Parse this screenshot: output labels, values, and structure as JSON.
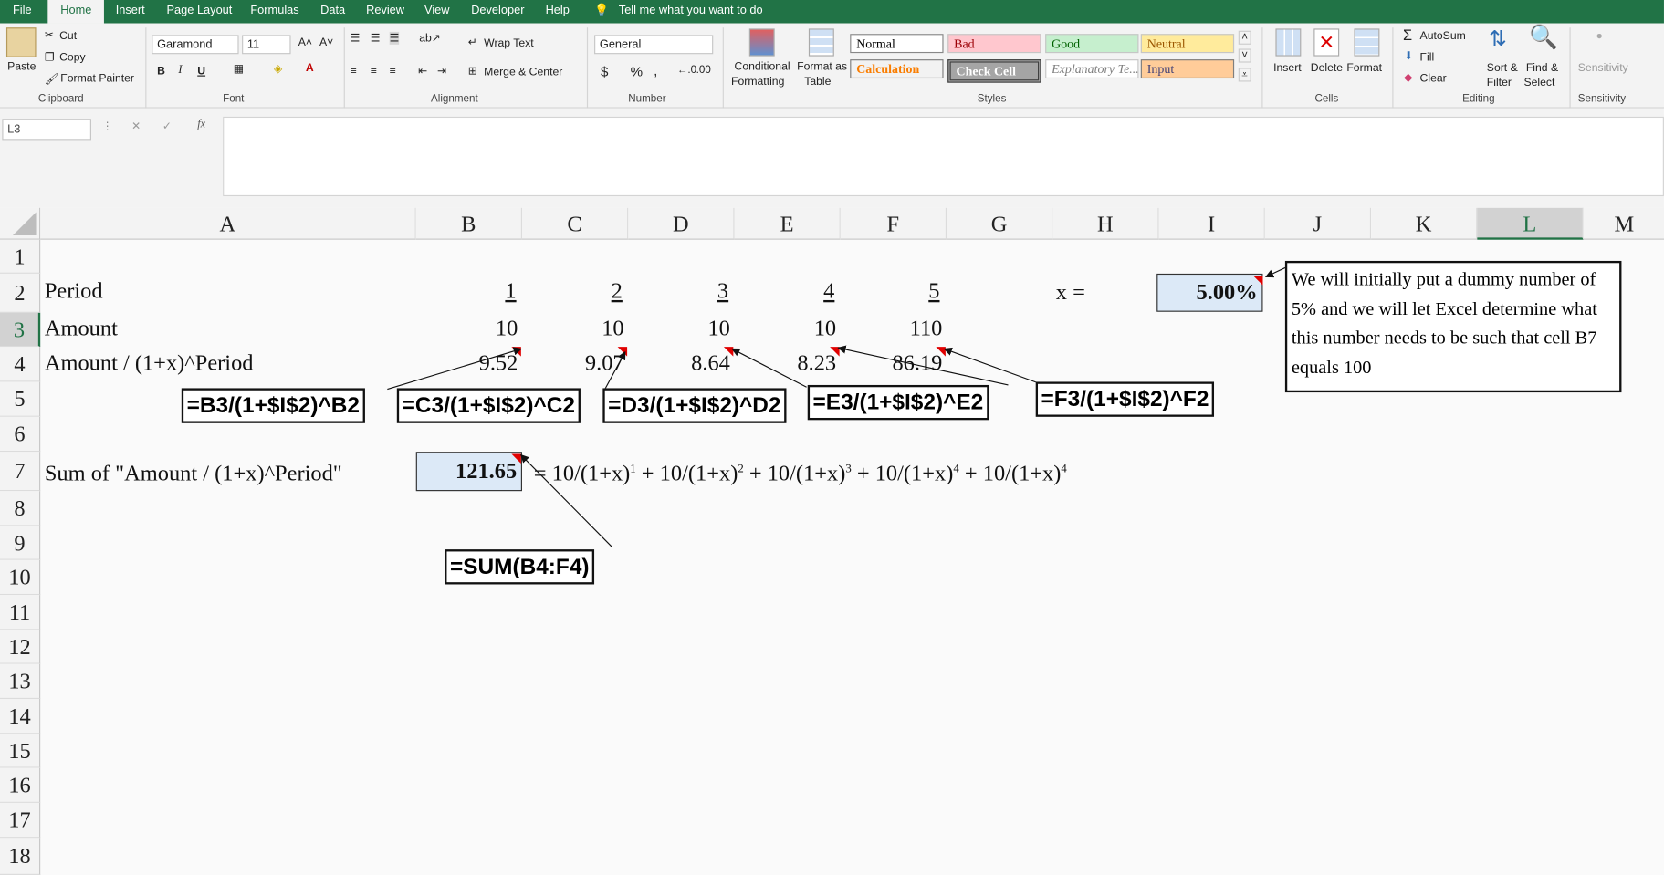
{
  "tabs": [
    "File",
    "Home",
    "Insert",
    "Page Layout",
    "Formulas",
    "Data",
    "Review",
    "View",
    "Developer",
    "Help",
    "Tell me what you want to do"
  ],
  "ribbon": {
    "clipboard": {
      "paste": "Paste",
      "cut": "Cut",
      "copy": "Copy",
      "format_painter": "Format Painter",
      "label": "Clipboard"
    },
    "font": {
      "name": "Garamond",
      "size": "11",
      "label": "Font",
      "bold": "B",
      "italic": "I",
      "underline": "U"
    },
    "alignment": {
      "wrap": "Wrap Text",
      "merge": "Merge & Center",
      "label": "Alignment"
    },
    "number": {
      "format": "General",
      "currency": "$",
      "percent": "%",
      "comma": ",",
      "label": "Number"
    },
    "styles": {
      "conditional": "Conditional",
      "conditional2": "Formatting",
      "format_table": "Format as",
      "format_table2": "Table",
      "normal": "Normal",
      "bad": "Bad",
      "good": "Good",
      "neutral": "Neutral",
      "calculation": "Calculation",
      "check": "Check Cell",
      "explanatory": "Explanatory Te...",
      "input": "Input",
      "label": "Styles"
    },
    "cells": {
      "insert": "Insert",
      "delete": "Delete",
      "format": "Format",
      "label": "Cells"
    },
    "editing": {
      "autosum": "AutoSum",
      "fill": "Fill",
      "clear": "Clear",
      "sort": "Sort &",
      "sort2": "Filter",
      "find": "Find &",
      "find2": "Select",
      "label": "Editing"
    },
    "sensitivity": {
      "btn": "Sensitivity",
      "label": "Sensitivity"
    }
  },
  "formula_bar": {
    "name_box": "L3",
    "cancel": "✕",
    "enter": "✓",
    "fx": "fx",
    "value": ""
  },
  "columns": [
    "A",
    "B",
    "C",
    "D",
    "E",
    "F",
    "G",
    "H",
    "I",
    "J",
    "K",
    "L",
    "M"
  ],
  "rows": [
    "1",
    "2",
    "3",
    "4",
    "5",
    "6",
    "7",
    "8",
    "9",
    "10",
    "11",
    "12",
    "13",
    "14",
    "15",
    "16",
    "17",
    "18"
  ],
  "cells": {
    "a2": "Period",
    "a3": "Amount",
    "a4": "Amount / (1+x)^Period",
    "a7": "Sum of \"Amount / (1+x)^Period\"",
    "periods": [
      "1",
      "2",
      "3",
      "4",
      "5"
    ],
    "amounts": [
      "10",
      "10",
      "10",
      "10",
      "110"
    ],
    "discounted": [
      "9.52",
      "9.07",
      "8.64",
      "8.23",
      "86.19"
    ],
    "h2": "x =",
    "i2": "5.00%",
    "b7": "121.65",
    "formula_text": {
      "eq": "= 10/(1+x)",
      "p1": "1",
      "t2": " + 10/(1+x)",
      "p2": "2",
      "t3": " + 10/(1+x)",
      "p3": "3",
      "t4": " + 10/(1+x)",
      "p4": "4",
      "t5": " + 10/(1+x)",
      "p5": "4"
    }
  },
  "callouts": [
    "=B3/(1+$I$2)^B2",
    "=C3/(1+$I$2)^C2",
    "=D3/(1+$I$2)^D2",
    "=E3/(1+$I$2)^E2",
    "=F3/(1+$I$2)^F2",
    "=SUM(B4:F4)"
  ],
  "note": "We will initially put a dummy number of 5% and we will let Excel determine what this number needs to be such that cell B7 equals 100",
  "colors": {
    "excel_green": "#217346",
    "input_fill": "#dce9f7",
    "red_marker": "#e00000"
  }
}
